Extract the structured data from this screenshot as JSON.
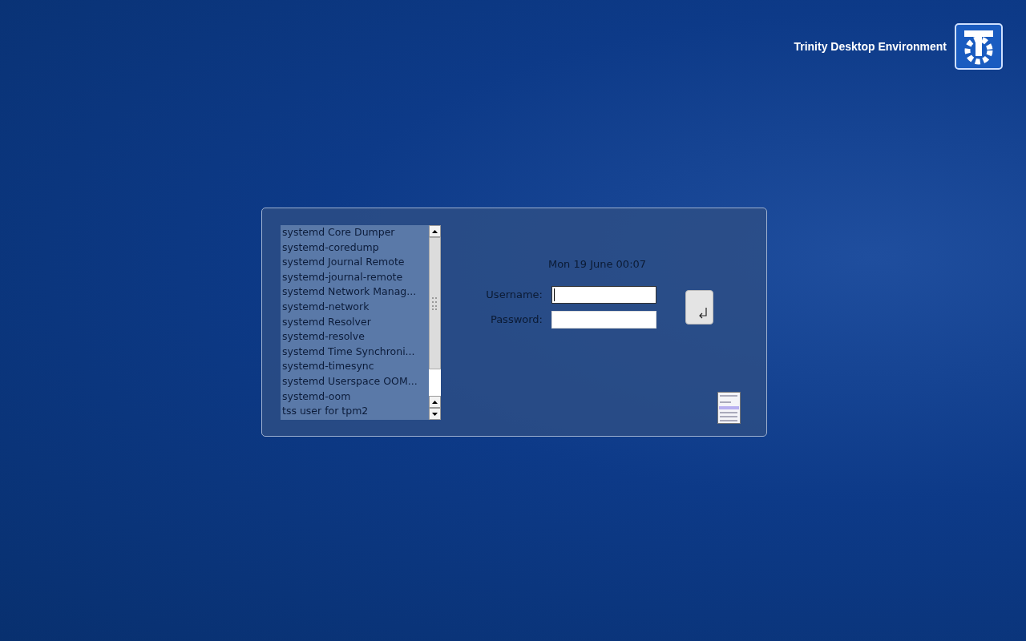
{
  "branding": {
    "title": "Trinity Desktop Environment"
  },
  "user_list": {
    "items": [
      "systemd Core Dumper",
      "systemd-coredump",
      "systemd Journal Remote",
      "systemd-journal-remote",
      "systemd Network Manag...",
      "systemd-network",
      "systemd Resolver",
      "systemd-resolve",
      "systemd Time Synchroni...",
      "systemd-timesync",
      "systemd Userspace OOM...",
      "systemd-oom",
      "tss user for tpm2"
    ]
  },
  "clock": "Mon 19 June 00:07",
  "fields": [
    {
      "label": "Username:",
      "focused": true
    },
    {
      "label": "Password:",
      "focused": false
    }
  ]
}
